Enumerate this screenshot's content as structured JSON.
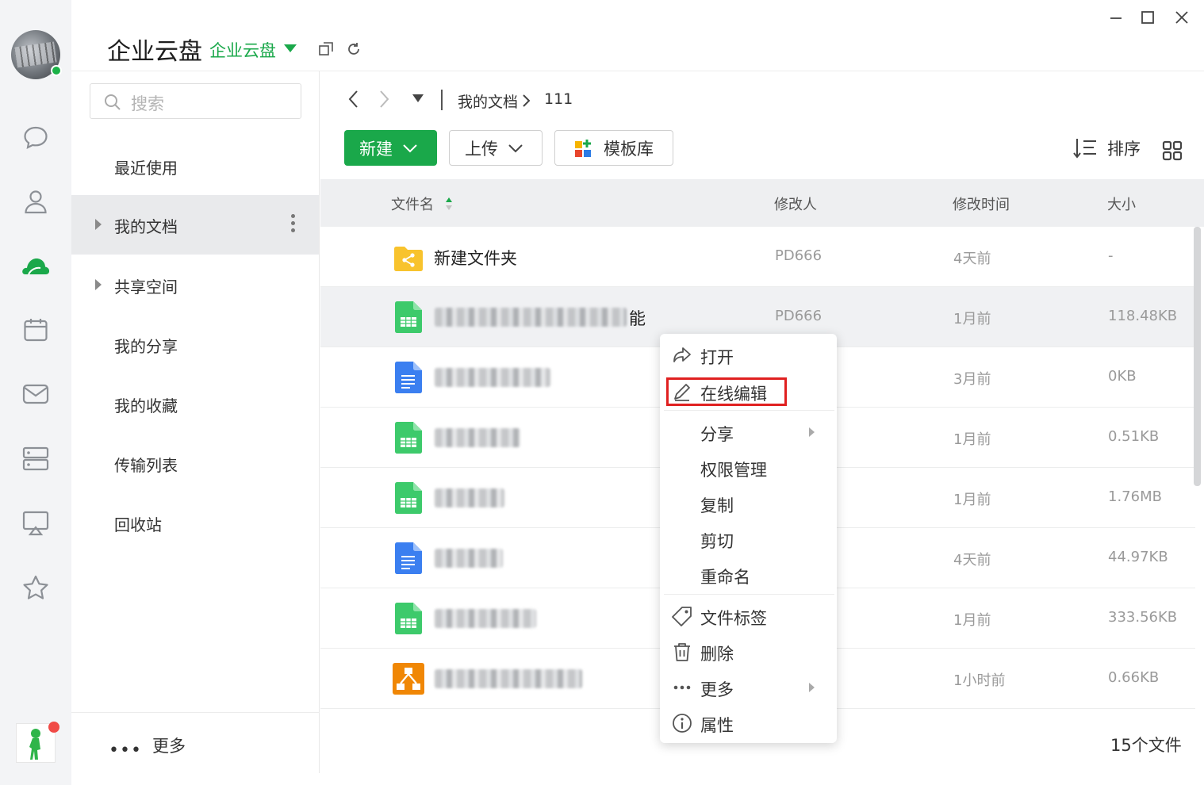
{
  "app": {
    "title": "企业云盘",
    "subtitle": "企业云盘"
  },
  "colors": {
    "brand": "#1aa84a",
    "highlight": "#e02020"
  },
  "rail": {
    "icons": [
      "chat-icon",
      "contacts-icon",
      "cloud-drive-icon",
      "calendar-icon",
      "mail-icon",
      "storage-icon",
      "screen-share-icon",
      "star-icon"
    ],
    "active": "cloud-drive-icon"
  },
  "search": {
    "placeholder": "搜索"
  },
  "sidebar": {
    "items": [
      {
        "label": "最近使用"
      },
      {
        "label": "我的文档"
      },
      {
        "label": "共享空间"
      },
      {
        "label": "我的分享"
      },
      {
        "label": "我的收藏"
      },
      {
        "label": "传输列表"
      },
      {
        "label": "回收站"
      }
    ],
    "more": "更多"
  },
  "breadcrumb": {
    "root": "我的文档",
    "current": "111"
  },
  "toolbar": {
    "new": "新建",
    "upload": "上传",
    "templates": "模板库",
    "sort": "排序"
  },
  "table": {
    "headers": {
      "name": "文件名",
      "modifier": "修改人",
      "modified": "修改时间",
      "size": "大小"
    },
    "rows": [
      {
        "type": "folder",
        "name": "新建文件夹",
        "modifier": "PD666",
        "modified": "4天前",
        "size": "-"
      },
      {
        "type": "sheet",
        "name": "能",
        "modifier": "PD666",
        "modified": "1月前",
        "size": "118.48KB"
      },
      {
        "type": "doc",
        "name": "",
        "modifier": "",
        "modified": "3月前",
        "size": "0KB"
      },
      {
        "type": "sheet",
        "name": "",
        "modifier": "",
        "modified": "1月前",
        "size": "0.51KB"
      },
      {
        "type": "sheet",
        "name": "",
        "modifier": "",
        "modified": "1月前",
        "size": "1.76MB"
      },
      {
        "type": "doc",
        "name": "",
        "modifier": "",
        "modified": "4天前",
        "size": "44.97KB"
      },
      {
        "type": "sheet",
        "name": "",
        "modifier": "",
        "modified": "1月前",
        "size": "333.56KB"
      },
      {
        "type": "drawio",
        "name": "",
        "modifier": "",
        "modified": "1小时前",
        "size": "0.66KB"
      }
    ]
  },
  "context_menu": {
    "items": [
      {
        "label": "打开",
        "icon": "share-arrow-icon"
      },
      {
        "label": "在线编辑",
        "icon": "pencil-icon",
        "highlighted": true
      },
      {
        "label": "分享",
        "icon": "",
        "submenu": true
      },
      {
        "label": "权限管理",
        "icon": ""
      },
      {
        "label": "复制",
        "icon": ""
      },
      {
        "label": "剪切",
        "icon": ""
      },
      {
        "label": "重命名",
        "icon": ""
      },
      {
        "label": "文件标签",
        "icon": "tag-icon"
      },
      {
        "label": "删除",
        "icon": "trash-icon"
      },
      {
        "label": "更多",
        "icon": "more-dots-icon",
        "submenu": true
      },
      {
        "label": "属性",
        "icon": "info-icon"
      }
    ]
  },
  "footer": {
    "file_count": "15个文件"
  }
}
